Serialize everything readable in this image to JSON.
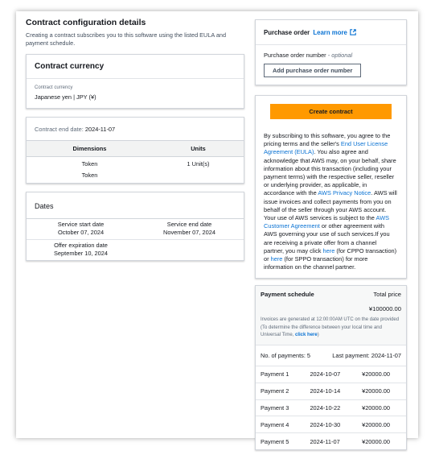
{
  "left": {
    "title": "Contract configuration details",
    "subtitle": "Creating a contract subscribes you to this software using the listed EULA and payment schedule.",
    "currency_card": {
      "heading": "Contract currency",
      "label": "Contract currency",
      "value": "Japanese yen | JPY (¥)"
    },
    "end_date": {
      "label": "Contract end date:",
      "value": "2024-11-07"
    },
    "dimensions": {
      "headers": [
        "Dimensions",
        "Units"
      ],
      "rows": [
        {
          "dimension": "Token",
          "units": "1 Unit(s)"
        },
        {
          "dimension": "Token",
          "units": ""
        }
      ]
    },
    "dates": {
      "heading": "Dates",
      "service_start_label": "Service start date",
      "service_start_value": "October 07, 2024",
      "service_end_label": "Service end date",
      "service_end_value": "November 07, 2024",
      "offer_expiration_label": "Offer expiration date",
      "offer_expiration_value": "September 10, 2024"
    }
  },
  "purchase_order": {
    "heading": "Purchase order",
    "learn_more": "Learn more",
    "number_label": "Purchase order number",
    "optional": "- optional",
    "add_button": "Add purchase order number"
  },
  "contract": {
    "create_button": "Create contract",
    "legal": {
      "t1": "By subscribing to this software, you agree to the pricing terms and the seller's ",
      "eula_link": "End User License Agreement (EULA)",
      "t2": ". You also agree and acknowledge that AWS may, on your behalf, share information about this transaction (including your payment terms) with the respective seller, reseller or underlying provider, as applicable, in accordance with the ",
      "privacy_link": "AWS Privacy Notice",
      "t3": ". AWS will issue invoices and collect payments from you on behalf of the seller through your AWS account. Your use of AWS services is subject to the ",
      "customer_link": "AWS Customer Agreement",
      "t4": " or other agreement with AWS governing your use of such services.If you are receiving a private offer from a channel partner, you may click ",
      "here1": "here",
      "t5": " (for CPPO transaction) or ",
      "here2": "here",
      "t6": " (for SPPO transaction) for more information on the channel partner."
    }
  },
  "payment": {
    "heading": "Payment schedule",
    "total_label": "Total price",
    "total_value": "¥100000.00",
    "note_1": "Invoices are generated at 12:00:00AM UTC on the date provided (To determine the difference between your local time and Universal Time, ",
    "note_link": "click here",
    "note_2": ")",
    "count_label": "No. of payments: 5",
    "last_label": "Last payment: 2024-11-07",
    "rows": [
      {
        "name": "Payment 1",
        "date": "2024-10-07",
        "amount": "¥20000.00"
      },
      {
        "name": "Payment 2",
        "date": "2024-10-14",
        "amount": "¥20000.00"
      },
      {
        "name": "Payment 3",
        "date": "2024-10-22",
        "amount": "¥20000.00"
      },
      {
        "name": "Payment 4",
        "date": "2024-10-30",
        "amount": "¥20000.00"
      },
      {
        "name": "Payment 5",
        "date": "2024-11-07",
        "amount": "¥20000.00"
      }
    ]
  },
  "colors": {
    "accent": "#ff9900",
    "link": "#0972d3",
    "text": "#16191f"
  }
}
